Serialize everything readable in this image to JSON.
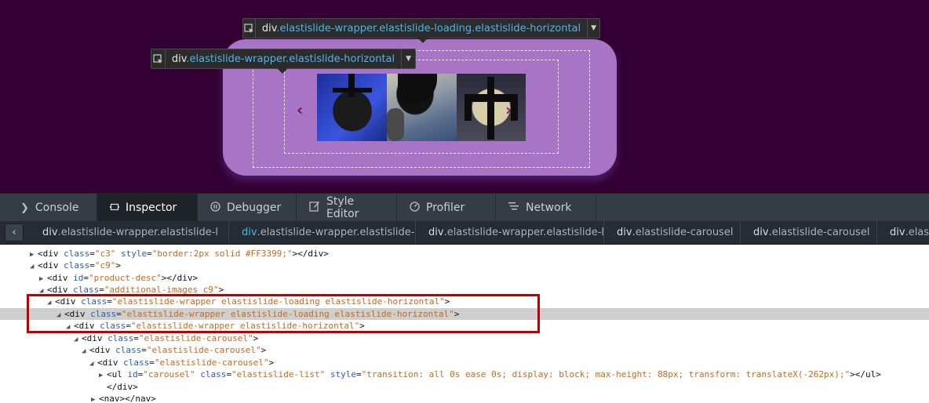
{
  "tooltip_top": {
    "tag": "div",
    "classes": ".elastislide-wrapper.elastislide-loading.elastislide-horizontal"
  },
  "tooltip_mid": {
    "tag": "div",
    "classes": ".elastislide-wrapper.elastislide-horizontal"
  },
  "carousel": {
    "prev": "‹",
    "next": "›"
  },
  "tabs": [
    {
      "label": "Console",
      "icon": "console-icon"
    },
    {
      "label": "Inspector",
      "icon": "inspector-icon",
      "active": true
    },
    {
      "label": "Debugger",
      "icon": "debugger-icon"
    },
    {
      "label": "Style Editor",
      "icon": "style-editor-icon"
    },
    {
      "label": "Profiler",
      "icon": "profiler-icon"
    },
    {
      "label": "Network",
      "icon": "network-icon"
    }
  ],
  "breadcrumbs": [
    {
      "tag": "div",
      "cls": ".elastislide-wrapper.elastislide-l"
    },
    {
      "tag": "div",
      "cls": ".elastislide-wrapper.elastislide-l",
      "selected": true
    },
    {
      "tag": "div",
      "cls": ".elastislide-wrapper.elastislide-h"
    },
    {
      "tag": "div",
      "cls": ".elastislide-carousel"
    },
    {
      "tag": "div",
      "cls": ".elastislide-carousel"
    },
    {
      "tag": "div",
      "cls": ".elastis"
    }
  ],
  "markup": {
    "l1": {
      "a": "<div ",
      "b": "class",
      "c": "=",
      "d": "\"c3\"",
      "e": " style",
      "f": "=",
      "g": "\"border:2px solid #FF3399;\"",
      "h": "></div>"
    },
    "l2": {
      "a": "<div ",
      "b": "class",
      "c": "=",
      "d": "\"c9\"",
      "h": ">"
    },
    "l3": {
      "a": "<div ",
      "b": "id",
      "c": "=",
      "d": "\"product-desc\"",
      "h": "></div>"
    },
    "l4": {
      "a": "<div ",
      "b": "class",
      "c": "=",
      "d": "\"additional-images c9\"",
      "h": ">"
    },
    "l5": {
      "a": "<div ",
      "b": "class",
      "c": "=",
      "d": "\"elastislide-wrapper elastislide-loading elastislide-horizontal\"",
      "h": ">"
    },
    "l6": {
      "a": "<div ",
      "b": "class",
      "c": "=",
      "d": "\"elastislide-wrapper elastislide-loading elastislide-horizontal\"",
      "h": ">"
    },
    "l7": {
      "a": "<div ",
      "b": "class",
      "c": "=",
      "d": "\"elastislide-wrapper elastislide-horizontal\"",
      "h": ">"
    },
    "l8": {
      "a": "<div ",
      "b": "class",
      "c": "=",
      "d": "\"elastislide-carousel\"",
      "h": ">"
    },
    "l9": {
      "a": "<div ",
      "b": "class",
      "c": "=",
      "d": "\"elastislide-carousel\"",
      "h": ">"
    },
    "l10": {
      "a": "<div ",
      "b": "class",
      "c": "=",
      "d": "\"elastislide-carousel\"",
      "h": ">"
    },
    "l11": {
      "a": "<ul ",
      "b": "id",
      "c": "=",
      "d": "\"carousel\"",
      "e": " class",
      "f": "=",
      "g": "\"elastislide-list\"",
      "i": " style",
      "j": "=",
      "k": "\"transition: all 0s ease 0s; display: block; max-height: 88px; transform: translateX(-262px);\"",
      "h": "></ul>"
    },
    "l12": {
      "a": "</div>"
    },
    "l13": {
      "a": "<nav></nav>"
    }
  }
}
